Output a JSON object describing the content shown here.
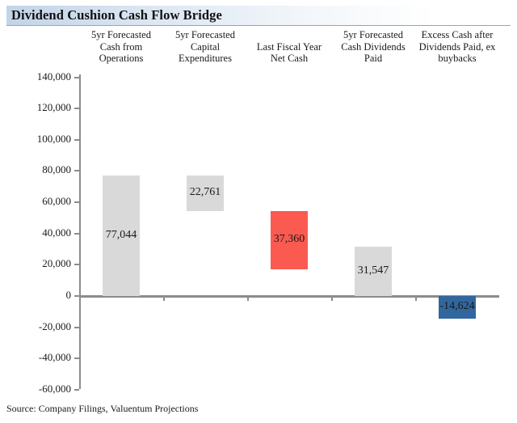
{
  "title": "Dividend Cushion Cash Flow Bridge",
  "source": "Source: Company Filings, Valuentum Projections",
  "colors": {
    "gray_bar": "#D9D9D9",
    "red_bar": "#FA5A50",
    "blue_bar": "#31679E",
    "axis": "#8C8C8C",
    "title_gradient_start": "#C2D4E8"
  },
  "chart_data": {
    "type": "bar",
    "chart_subtype": "waterfall",
    "title": "Dividend Cushion Cash Flow Bridge",
    "xlabel": "",
    "ylabel": "",
    "ylim": [
      -60000,
      140000
    ],
    "ytick_step": 20000,
    "grid": false,
    "legend": "none",
    "ytick_labels": [
      "140,000",
      "120,000",
      "100,000",
      "80,000",
      "60,000",
      "40,000",
      "20,000",
      "0",
      "-20,000",
      "-40,000",
      "-60,000"
    ],
    "ytick_values": [
      140000,
      120000,
      100000,
      80000,
      60000,
      40000,
      20000,
      0,
      -20000,
      -40000,
      -60000
    ],
    "categories": [
      "5yr Forecasted Cash from Operations",
      "5yr Forecasted Capital Expenditures",
      "Last Fiscal Year Net Cash",
      "5yr Forecasted Cash Dividends Paid",
      "Excess Cash after Dividends Paid, ex buybacks"
    ],
    "values": [
      77044,
      22761,
      37360,
      31547,
      -14624
    ],
    "data_labels": [
      "77,044",
      "22,761",
      "37,360",
      "31,547",
      "-14,624"
    ],
    "bars": [
      {
        "label_lines": [
          "5yr Forecasted",
          "Cash from",
          "Operations"
        ],
        "value": 77044,
        "data_label": "77,044",
        "base": 0,
        "top": 77044,
        "color": "#D9D9D9",
        "kind": "total"
      },
      {
        "label_lines": [
          "5yr Forecasted",
          "Capital",
          "Expenditures"
        ],
        "value": 22761,
        "data_label": "22,761",
        "base": 54283,
        "top": 77044,
        "color": "#D9D9D9",
        "kind": "decrease"
      },
      {
        "label_lines": [
          "Last Fiscal Year",
          "Net Cash"
        ],
        "value": 37360,
        "data_label": "37,360",
        "base": 16923,
        "top": 54283,
        "color": "#FA5A50",
        "kind": "increase"
      },
      {
        "label_lines": [
          "5yr Forecasted",
          "Cash Dividends",
          "Paid"
        ],
        "value": 31547,
        "data_label": "31,547",
        "base": 0,
        "top": 31547,
        "color": "#D9D9D9",
        "kind": "decrease"
      },
      {
        "label_lines": [
          "Excess Cash after",
          "Dividends Paid, ex",
          "buybacks"
        ],
        "value": -14624,
        "data_label": "-14,624",
        "base": -14624,
        "top": 0,
        "color": "#31679E",
        "kind": "total"
      }
    ]
  }
}
